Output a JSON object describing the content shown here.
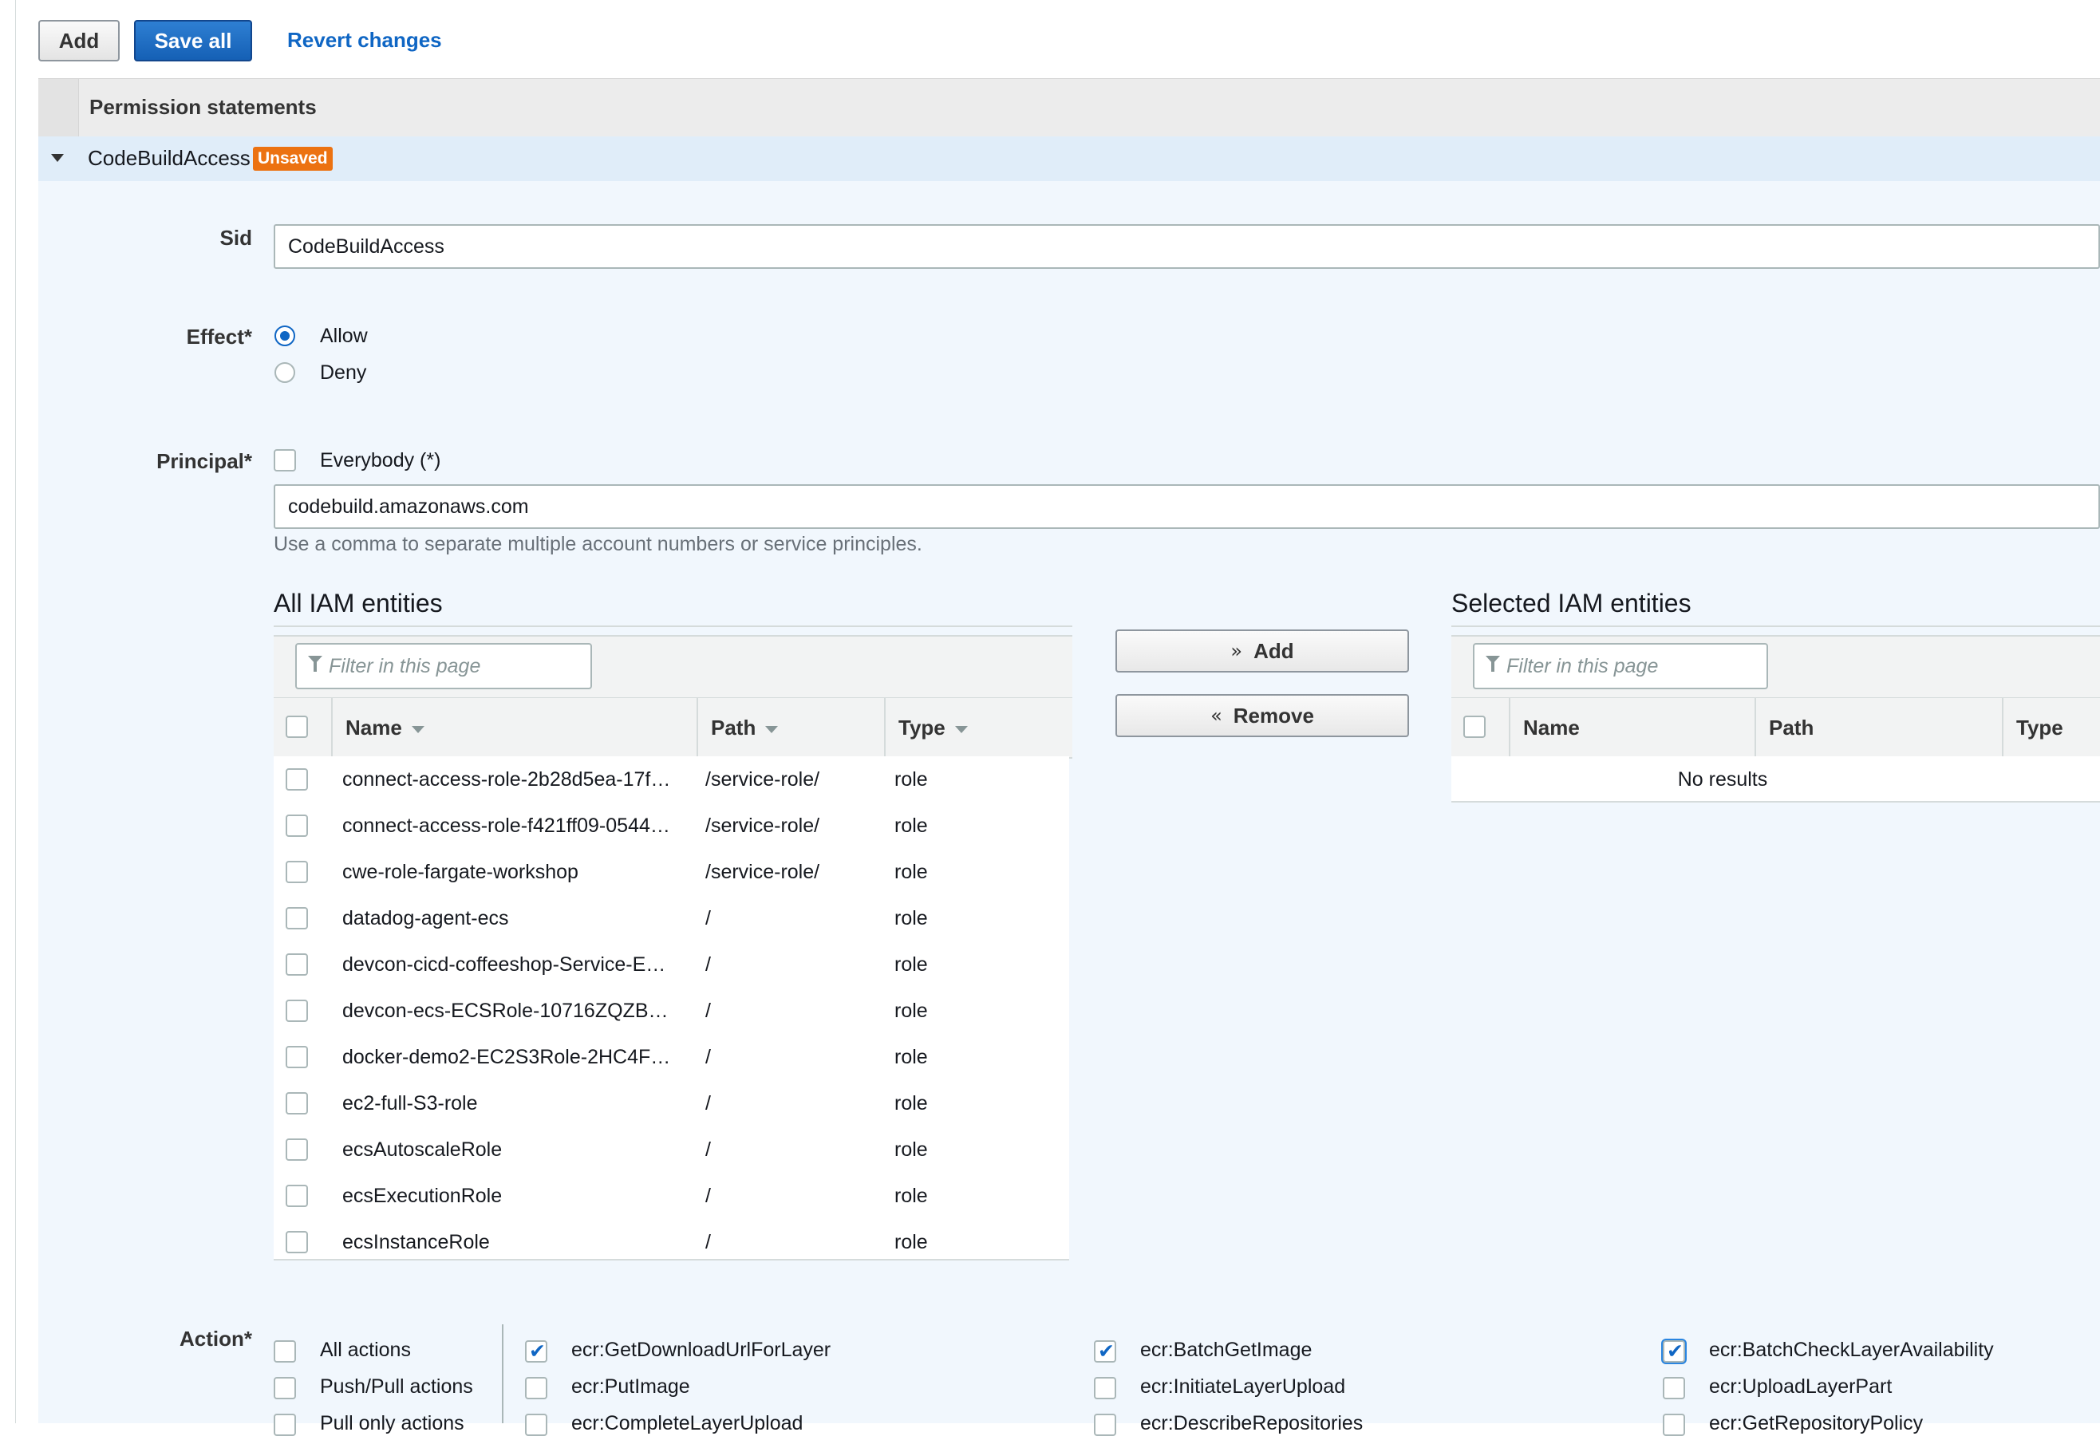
{
  "toolbar": {
    "add_label": "Add",
    "save_all_label": "Save all",
    "revert_label": "Revert changes"
  },
  "permissions": {
    "header": "Permission statements",
    "statement_name": "CodeBuildAccess",
    "statement_badge": "Unsaved"
  },
  "form": {
    "sid_label": "Sid",
    "sid_value": "CodeBuildAccess",
    "effect_label": "Effect*",
    "effect_options": [
      "Allow",
      "Deny"
    ],
    "effect_selected": "Allow",
    "principal_label": "Principal*",
    "everybody_label": "Everybody (*)",
    "principal_value": "codebuild.amazonaws.com",
    "principal_hint": "Use a comma to separate multiple account numbers or service principles.",
    "action_label": "Action*"
  },
  "all_entities": {
    "title": "All IAM entities",
    "filter_placeholder": "Filter in this page",
    "columns": [
      "Name",
      "Path",
      "Type"
    ],
    "rows": [
      {
        "name": "connect-access-role-2b28d5ea-17f…",
        "path": "/service-role/",
        "type": "role"
      },
      {
        "name": "connect-access-role-f421ff09-0544…",
        "path": "/service-role/",
        "type": "role"
      },
      {
        "name": "cwe-role-fargate-workshop",
        "path": "/service-role/",
        "type": "role"
      },
      {
        "name": "datadog-agent-ecs",
        "path": "/",
        "type": "role"
      },
      {
        "name": "devcon-cicd-coffeeshop-Service-E…",
        "path": "/",
        "type": "role"
      },
      {
        "name": "devcon-ecs-ECSRole-10716ZQZB…",
        "path": "/",
        "type": "role"
      },
      {
        "name": "docker-demo2-EC2S3Role-2HC4F…",
        "path": "/",
        "type": "role"
      },
      {
        "name": "ec2-full-S3-role",
        "path": "/",
        "type": "role"
      },
      {
        "name": "ecsAutoscaleRole",
        "path": "/",
        "type": "role"
      },
      {
        "name": "ecsExecutionRole",
        "path": "/",
        "type": "role"
      },
      {
        "name": "ecsInstanceRole",
        "path": "/",
        "type": "role"
      }
    ]
  },
  "move_buttons": {
    "add_label": "Add",
    "remove_label": "Remove"
  },
  "selected_entities": {
    "title": "Selected IAM entities",
    "filter_placeholder": "Filter in this page",
    "columns": [
      "Name",
      "Path",
      "Type"
    ],
    "empty_text": "No results"
  },
  "actions": {
    "groups": [
      {
        "label": "All actions",
        "checked": false
      },
      {
        "label": "Push/Pull actions",
        "checked": false
      },
      {
        "label": "Pull only actions",
        "checked": false
      }
    ],
    "col1": [
      {
        "label": "ecr:GetDownloadUrlForLayer",
        "checked": true
      },
      {
        "label": "ecr:PutImage",
        "checked": false
      },
      {
        "label": "ecr:CompleteLayerUpload",
        "checked": false
      }
    ],
    "col2": [
      {
        "label": "ecr:BatchGetImage",
        "checked": true
      },
      {
        "label": "ecr:InitiateLayerUpload",
        "checked": false
      },
      {
        "label": "ecr:DescribeRepositories",
        "checked": false
      }
    ],
    "col3": [
      {
        "label": "ecr:BatchCheckLayerAvailability",
        "checked": true
      },
      {
        "label": "ecr:UploadLayerPart",
        "checked": false
      },
      {
        "label": "ecr:GetRepositoryPolicy",
        "checked": false
      }
    ]
  },
  "colors": {
    "primary": "#1560b5",
    "link": "#0f66c4",
    "badge": "#ec7211",
    "panel_bg": "#f1f7fd"
  }
}
